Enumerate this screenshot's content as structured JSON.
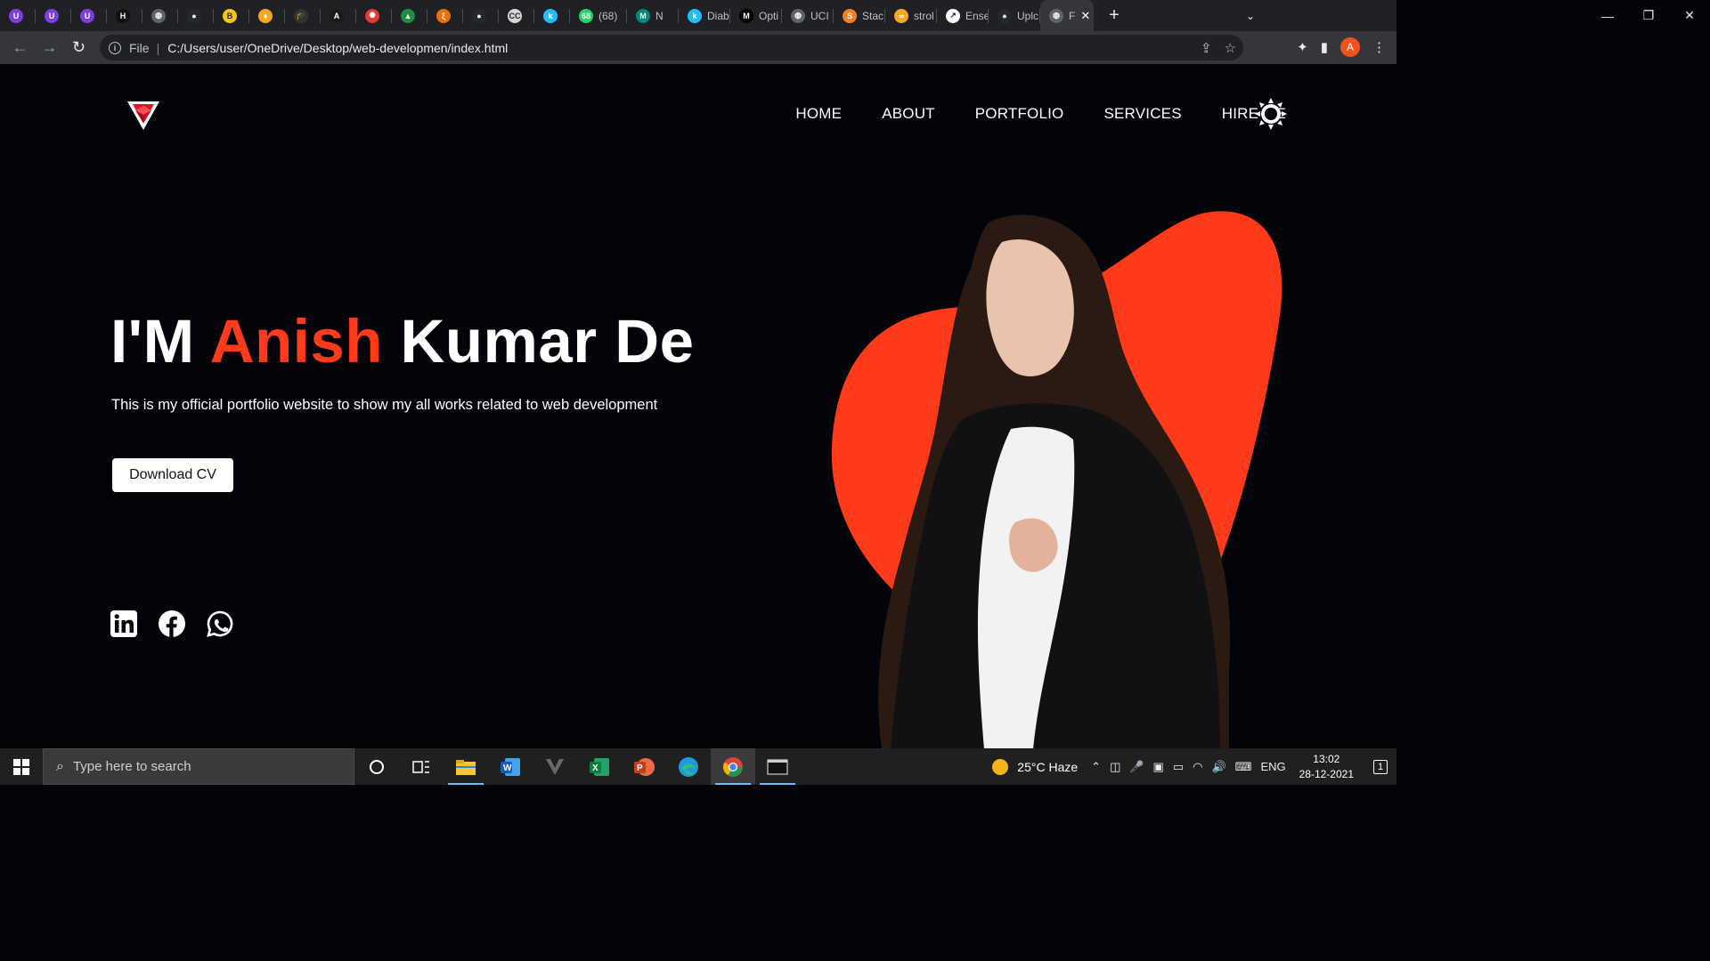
{
  "browser": {
    "tabs": [
      {
        "title": "",
        "color": "#7b3fe4",
        "glyph": "U"
      },
      {
        "title": "",
        "color": "#7b3fe4",
        "glyph": "U"
      },
      {
        "title": "",
        "color": "#7b3fe4",
        "glyph": "U"
      },
      {
        "title": "",
        "color": "#111111",
        "glyph": "H"
      },
      {
        "title": "",
        "color": "#5f6368",
        "glyph": "◍"
      },
      {
        "title": "",
        "color": "#24292e",
        "glyph": "●"
      },
      {
        "title": "",
        "color": "#f5c518",
        "glyph": "B"
      },
      {
        "title": "",
        "color": "#f5a623",
        "glyph": "♦"
      },
      {
        "title": "",
        "color": "#333333",
        "glyph": "🎓"
      },
      {
        "title": "",
        "color": "#1a1a1a",
        "glyph": "A"
      },
      {
        "title": "",
        "color": "#e53935",
        "glyph": "✺"
      },
      {
        "title": "",
        "color": "#1e8e3e",
        "glyph": "▲"
      },
      {
        "title": "",
        "color": "#e8710a",
        "glyph": "ξ"
      },
      {
        "title": "",
        "color": "#24292e",
        "glyph": "●"
      },
      {
        "title": "",
        "color": "#d6d6d6",
        "glyph": "CC"
      },
      {
        "title": "",
        "color": "#20beff",
        "glyph": "k"
      },
      {
        "title": "(68)",
        "color": "#25d366",
        "glyph": "68"
      },
      {
        "title": "N",
        "color": "#00897b",
        "glyph": "M"
      },
      {
        "title": "Diab",
        "color": "#20beff",
        "glyph": "k"
      },
      {
        "title": "Opti",
        "color": "#000000",
        "glyph": "M"
      },
      {
        "title": "UCI",
        "color": "#5f6368",
        "glyph": "◍"
      },
      {
        "title": "Stac",
        "color": "#f48024",
        "glyph": "S"
      },
      {
        "title": "strol",
        "color": "#f5a623",
        "glyph": "∞"
      },
      {
        "title": "Ense",
        "color": "#ffffff",
        "glyph": "↗"
      },
      {
        "title": "Uplc",
        "color": "#24292e",
        "glyph": "●"
      },
      {
        "title": "F",
        "color": "#5f6368",
        "glyph": "◍",
        "active": true
      }
    ],
    "new_tab": "+",
    "url_scheme_label": "File",
    "url": "C:/Users/user/OneDrive/Desktop/web-developmen/index.html",
    "profile_initial": "A"
  },
  "site": {
    "nav": [
      "HOME",
      "ABOUT",
      "PORTFOLIO",
      "SERVICES",
      "HIRE ME"
    ],
    "hero": {
      "prefix": "I'M",
      "highlight": "Anish",
      "suffix": "Kumar De",
      "subtitle": "This is my official portfolio website to show my all works related to web development",
      "cta": "Download CV"
    },
    "socials": [
      "linkedin-icon",
      "facebook-icon",
      "whatsapp-icon"
    ],
    "colors": {
      "accent": "#ff3b1c",
      "background": "#03030a"
    }
  },
  "taskbar": {
    "search_placeholder": "Type here to search",
    "weather": "25°C  Haze",
    "language": "ENG",
    "time": "13:02",
    "date": "28-12-2021",
    "notification_count": "1"
  }
}
